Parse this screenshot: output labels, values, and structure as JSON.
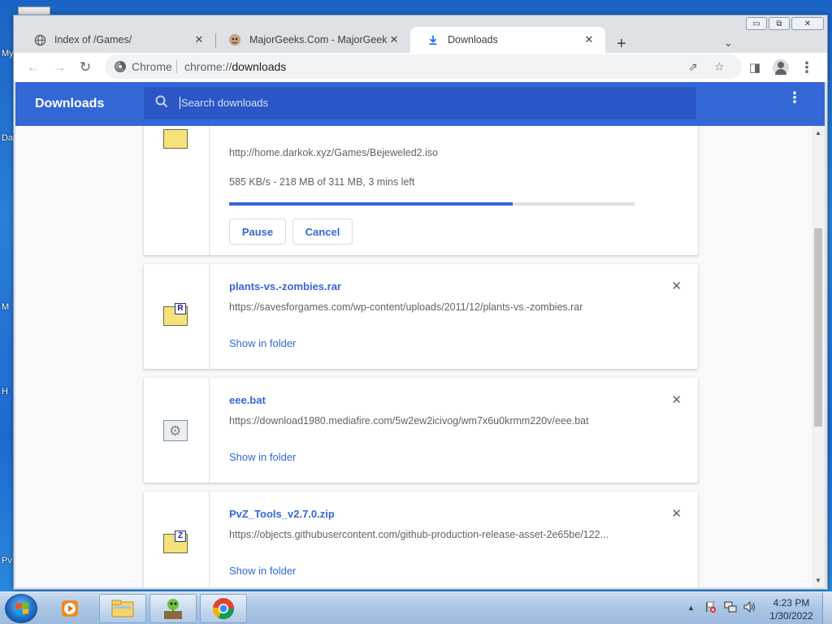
{
  "desktop": {
    "labels": [
      "My",
      "Da",
      "M",
      "H",
      "Pv"
    ]
  },
  "window_controls": {
    "minimize": "▭",
    "restore": "⧉",
    "close": "✕"
  },
  "tabs": [
    {
      "title": "Index of /Games/",
      "icon": "globe-icon",
      "close": "✕"
    },
    {
      "title": "MajorGeeks.Com - MajorGeeks",
      "icon": "majorgeeks-icon",
      "close": "✕"
    },
    {
      "title": "Downloads",
      "icon": "download-icon",
      "close": "✕",
      "active": true
    }
  ],
  "toolbar": {
    "new_tab": "+",
    "tab_search": "⌄",
    "back": "←",
    "forward": "→",
    "reload": "↻",
    "site_label": "Chrome",
    "url_scheme": "chrome://",
    "url_rest": "downloads",
    "share": "⇗",
    "bookmark": "☆",
    "side_panel": "◨",
    "menu": "⋮"
  },
  "downloads_header": {
    "title": "Downloads",
    "search_placeholder": "Search downloads",
    "menu": "⋮"
  },
  "downloads": [
    {
      "url": "http://home.darkok.xyz/Games/Bejeweled2.iso",
      "status": "585 KB/s - 218 MB of 311 MB, 3 mins left",
      "progress": 0.7,
      "pause_label": "Pause",
      "cancel_label": "Cancel"
    },
    {
      "name": "plants-vs.-zombies.rar",
      "url": "https://savesforgames.com/wp-content/uploads/2011/12/plants-vs.-zombies.rar",
      "link": "Show in folder",
      "badge": "R",
      "remove": "✕"
    },
    {
      "name": "eee.bat",
      "url": "https://download1980.mediafire.com/5w2ew2icivog/wm7x6u0krmm220v/eee.bat",
      "link": "Show in folder",
      "remove": "✕"
    },
    {
      "name": "PvZ_Tools_v2.7.0.zip",
      "url": "https://objects.githubusercontent.com/github-production-release-asset-2e65be/122...",
      "link": "Show in folder",
      "badge": "Z",
      "remove": "✕"
    }
  ],
  "scrollbar": {
    "up": "▲",
    "down": "▼"
  },
  "taskbar": {
    "tray_expand": "▲",
    "time": "4:23 PM",
    "date": "1/30/2022"
  },
  "colors": {
    "accent": "#3367d6",
    "header_bg": "#3367d6",
    "search_bg": "#2a56c6",
    "link": "#3367d6"
  }
}
